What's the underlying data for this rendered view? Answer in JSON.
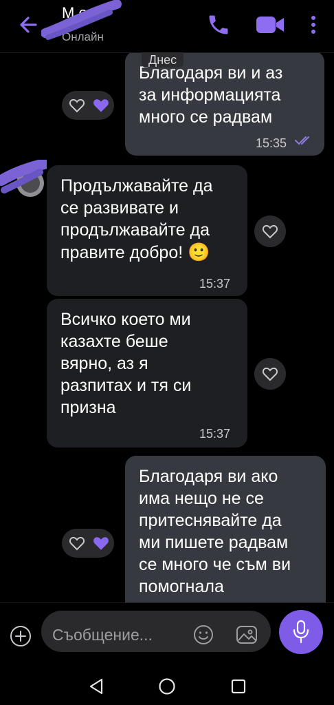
{
  "header": {
    "contact_name": "М о",
    "contact_status": "Онлайн",
    "icons": [
      "back-arrow-icon",
      "phone-icon",
      "video-camera-icon",
      "more-vertical-icon"
    ]
  },
  "colors": {
    "accent": "#7e5ce8",
    "outgoing_bubble": "#373941",
    "incoming_bubble": "#1e1f22",
    "background": "#000000"
  },
  "date_label": "Днес",
  "messages": [
    {
      "direction": "outgoing",
      "text": "Благодаря ви и аз\nза информацията\nмного се радвам",
      "time": "15:35",
      "read": true,
      "liked": true
    },
    {
      "direction": "incoming",
      "text": "Продължавайте да\nсе развивате и\nпродължавайте да\nправите добро!",
      "emoji": "🙂",
      "time": "15:37",
      "liked": false
    },
    {
      "direction": "incoming",
      "text": "Всичко което ми\nказахте беше\nвярно, аз я\nразпитах и тя си\nпризна",
      "time": "15:37",
      "liked": false
    },
    {
      "direction": "outgoing",
      "text": "Благодаря ви ако\nима нещо не се\nпритеснявайте да\nми пишете радвам\nсе много че съм ви\nпомогнала",
      "liked": true
    }
  ],
  "composer": {
    "placeholder": "Съобщение...",
    "icons": [
      "plus-icon",
      "emoji-icon",
      "gallery-icon",
      "microphone-icon"
    ]
  },
  "nav": {
    "icons": [
      "back-triangle-icon",
      "home-circle-icon",
      "recents-square-icon"
    ]
  }
}
